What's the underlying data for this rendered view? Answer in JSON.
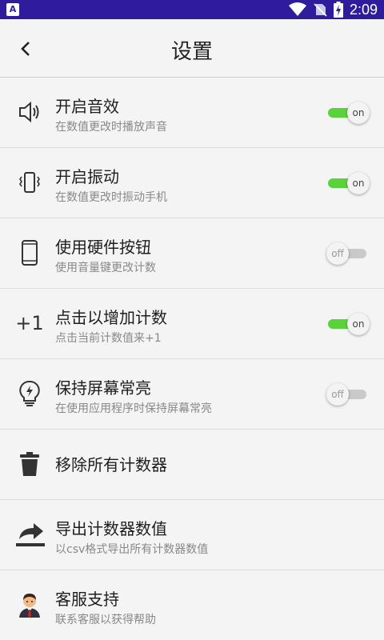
{
  "status_bar": {
    "left_badge": "A",
    "time": "2:09",
    "icons": [
      "wifi-icon",
      "no-sim-icon",
      "battery-charging-icon"
    ]
  },
  "header": {
    "title": "设置",
    "back_icon": "chevron-left-icon"
  },
  "settings": [
    {
      "title": "开启音效",
      "subtitle": "在数值更改时播放声音",
      "icon": "speaker-icon",
      "toggle": "on"
    },
    {
      "title": "开启振动",
      "subtitle": "在数值更改时振动手机",
      "icon": "vibrate-icon",
      "toggle": "on"
    },
    {
      "title": "使用硬件按钮",
      "subtitle": "使用音量键更改计数",
      "icon": "phone-icon",
      "toggle": "off"
    },
    {
      "title": "点击以增加计数",
      "subtitle": "点击当前计数值来+1",
      "icon_text": "+1",
      "toggle": "on"
    },
    {
      "title": "保持屏幕常亮",
      "subtitle": "在使用应用程序时保持屏幕常亮",
      "icon": "lightbulb-icon",
      "toggle": "off"
    },
    {
      "title": "移除所有计数器",
      "icon": "trash-icon"
    },
    {
      "title": "导出计数器数值",
      "subtitle": "以csv格式导出所有计数器数值",
      "icon": "share-export-icon"
    },
    {
      "title": "客服支持",
      "subtitle": "联系客服以获得帮助",
      "icon": "support-agent-icon"
    }
  ],
  "colors": {
    "status_bar": "#2f1c9c",
    "toggle_on": "#5ad23c",
    "toggle_off": "#c9c9c9"
  }
}
